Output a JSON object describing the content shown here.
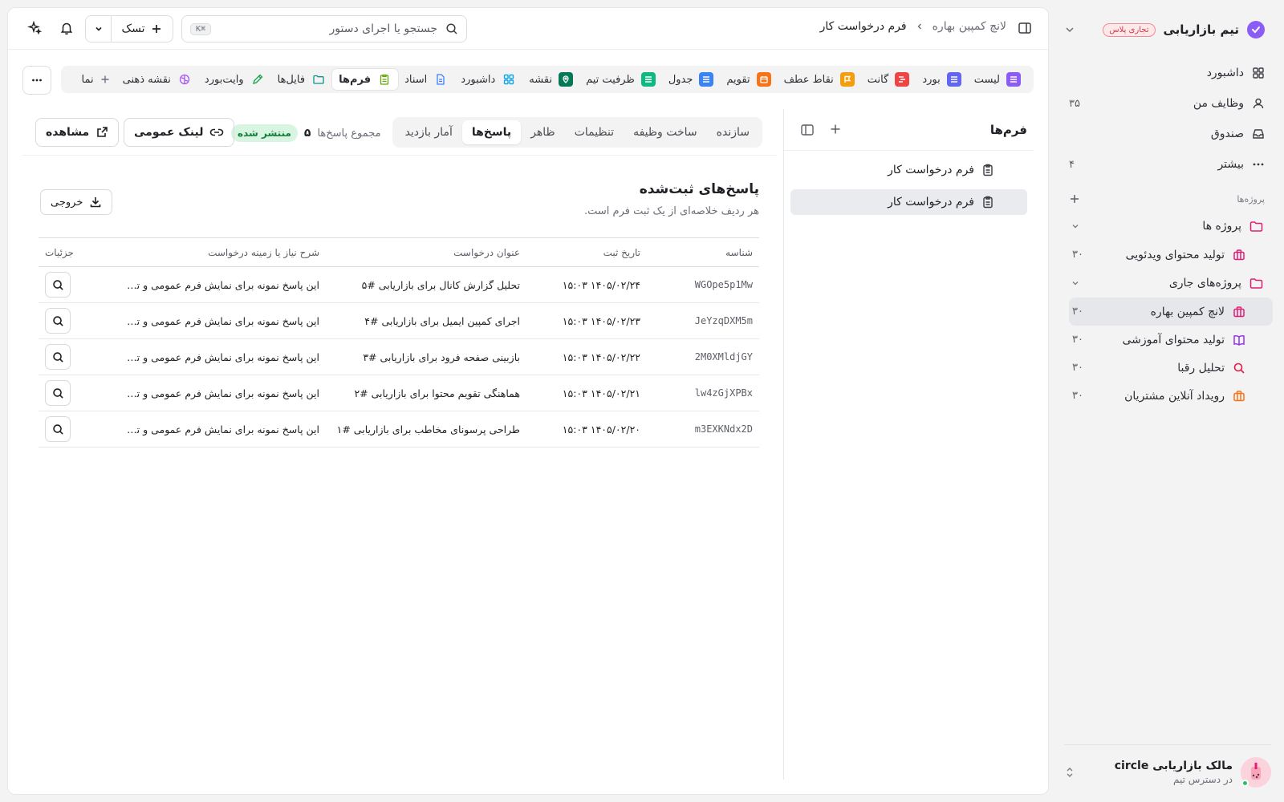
{
  "sidebar": {
    "team_name": "تیم بازاریابی",
    "plan_badge": "تجاری پلاس",
    "nav": [
      {
        "label": "داشبورد",
        "count": ""
      },
      {
        "label": "وظایف من",
        "count": "۳۵"
      },
      {
        "label": "صندوق",
        "count": ""
      },
      {
        "label": "بیشتر",
        "count": "۴"
      }
    ],
    "projects_label": "پروژه‌ها",
    "folders": [
      {
        "label": "پروژه ها",
        "items": [
          {
            "label": "تولید محتوای ویدئویی",
            "count": "۳۰",
            "color": "#e11d74"
          }
        ]
      },
      {
        "label": "پروژه‌های جاری",
        "items": [
          {
            "label": "لانچ کمپین بهاره",
            "count": "۳۰",
            "color": "#e11d74"
          },
          {
            "label": "تولید محتوای آموزشی",
            "count": "۳۰",
            "color": "#9333ea"
          },
          {
            "label": "تحلیل رقبا",
            "count": "۳۰",
            "color": "#e11d48"
          },
          {
            "label": "رویداد آنلاین مشتریان",
            "count": "۳۰",
            "color": "#f97316"
          }
        ]
      }
    ],
    "user": {
      "name": "مالک بازاریابی circle",
      "subtitle": "در دسترس تیم"
    }
  },
  "topbar": {
    "breadcrumb_parent": "لانچ کمپین بهاره",
    "breadcrumb_current": "فرم درخواست کار",
    "search_placeholder": "جستجو یا اجرای دستور",
    "search_shortcut": "⌘K",
    "task_label": "تسک"
  },
  "views": [
    {
      "label": "لیست",
      "color": "#8b5cf6",
      "icon": "list-icon"
    },
    {
      "label": "بورد",
      "color": "#6366f1",
      "icon": "board-icon"
    },
    {
      "label": "گانت",
      "color": "#ef4444",
      "icon": "gantt-icon"
    },
    {
      "label": "نقاط عطف",
      "color": "#f59e0b",
      "icon": "flag-icon"
    },
    {
      "label": "تقویم",
      "color": "#f97316",
      "icon": "calendar-icon"
    },
    {
      "label": "جدول",
      "color": "#3b82f6",
      "icon": "table-icon"
    },
    {
      "label": "ظرفیت تیم",
      "color": "#10b981",
      "icon": "capacity-icon"
    },
    {
      "label": "نقشه",
      "color": "#047857",
      "icon": "map-pin-icon"
    },
    {
      "label": "داشبورد",
      "color": "#0ea5e9",
      "icon": "dashboard-icon"
    },
    {
      "label": "اسناد",
      "color": "#3b82f6",
      "icon": "doc-icon"
    },
    {
      "label": "فرم‌ها",
      "color": "#65a30d",
      "icon": "form-icon"
    },
    {
      "label": "فایل‌ها",
      "color": "#0d9488",
      "icon": "folder-icon"
    },
    {
      "label": "وایت‌بورد",
      "color": "#16a34a",
      "icon": "pen-icon"
    },
    {
      "label": "نقشه ذهنی",
      "color": "#a855f7",
      "icon": "brain-icon"
    },
    {
      "label": "نما",
      "color": "#6b7280",
      "icon": "plus-icon"
    }
  ],
  "forms_panel": {
    "title": "فرم‌ها",
    "items": [
      "فرم درخواست کار",
      "فرم درخواست کار"
    ]
  },
  "content": {
    "tabs": [
      "سازنده",
      "ساخت وظیفه",
      "تنظیمات",
      "ظاهر",
      "پاسخ‌ها",
      "آمار بازدید"
    ],
    "active_tab": 4,
    "total_label": "مجموع پاسخ‌ها",
    "total_value": "۵",
    "status": "منتشر شده",
    "public_link_label": "لینک عمومی",
    "view_label": "مشاهده",
    "section_title": "پاسخ‌های ثبت‌شده",
    "section_sub": "هر ردیف خلاصه‌ای از یک ثبت فرم است.",
    "export_label": "خروجی",
    "columns": [
      "شناسه",
      "تاریخ ثبت",
      "عنوان درخواست",
      "شرح نیاز یا زمینه درخواست",
      "جزئیات"
    ],
    "rows": [
      {
        "id": "WGOpe5p1Mw",
        "date": "۱۴۰۵/۰۲/۲۴ ۱۵:۰۳",
        "title": "تحلیل گزارش کانال برای بازاریابی #۵",
        "desc": "این پاسخ نمونه برای نمایش فرم عمومی و تب..."
      },
      {
        "id": "JeYzqDXM5m",
        "date": "۱۴۰۵/۰۲/۲۳ ۱۵:۰۳",
        "title": "اجرای کمپین ایمیل برای بازاریابی #۴",
        "desc": "این پاسخ نمونه برای نمایش فرم عمومی و تب..."
      },
      {
        "id": "2M0XMldjGY",
        "date": "۱۴۰۵/۰۲/۲۲ ۱۵:۰۳",
        "title": "بازبینی صفحه فرود برای بازاریابی #۳",
        "desc": "این پاسخ نمونه برای نمایش فرم عمومی و تب..."
      },
      {
        "id": "lw4zGjXPBx",
        "date": "۱۴۰۵/۰۲/۲۱ ۱۵:۰۳",
        "title": "هماهنگی تقویم محتوا برای بازاریابی #۲",
        "desc": "این پاسخ نمونه برای نمایش فرم عمومی و تب..."
      },
      {
        "id": "m3EXKNdx2D",
        "date": "۱۴۰۵/۰۲/۲۰ ۱۵:۰۳",
        "title": "طراحی پرسونای مخاطب برای بازاریابی #۱",
        "desc": "این پاسخ نمونه برای نمایش فرم عمومی و تب..."
      }
    ]
  },
  "colors": {
    "accent_badge": "#d3384b",
    "published": "#15803d"
  }
}
